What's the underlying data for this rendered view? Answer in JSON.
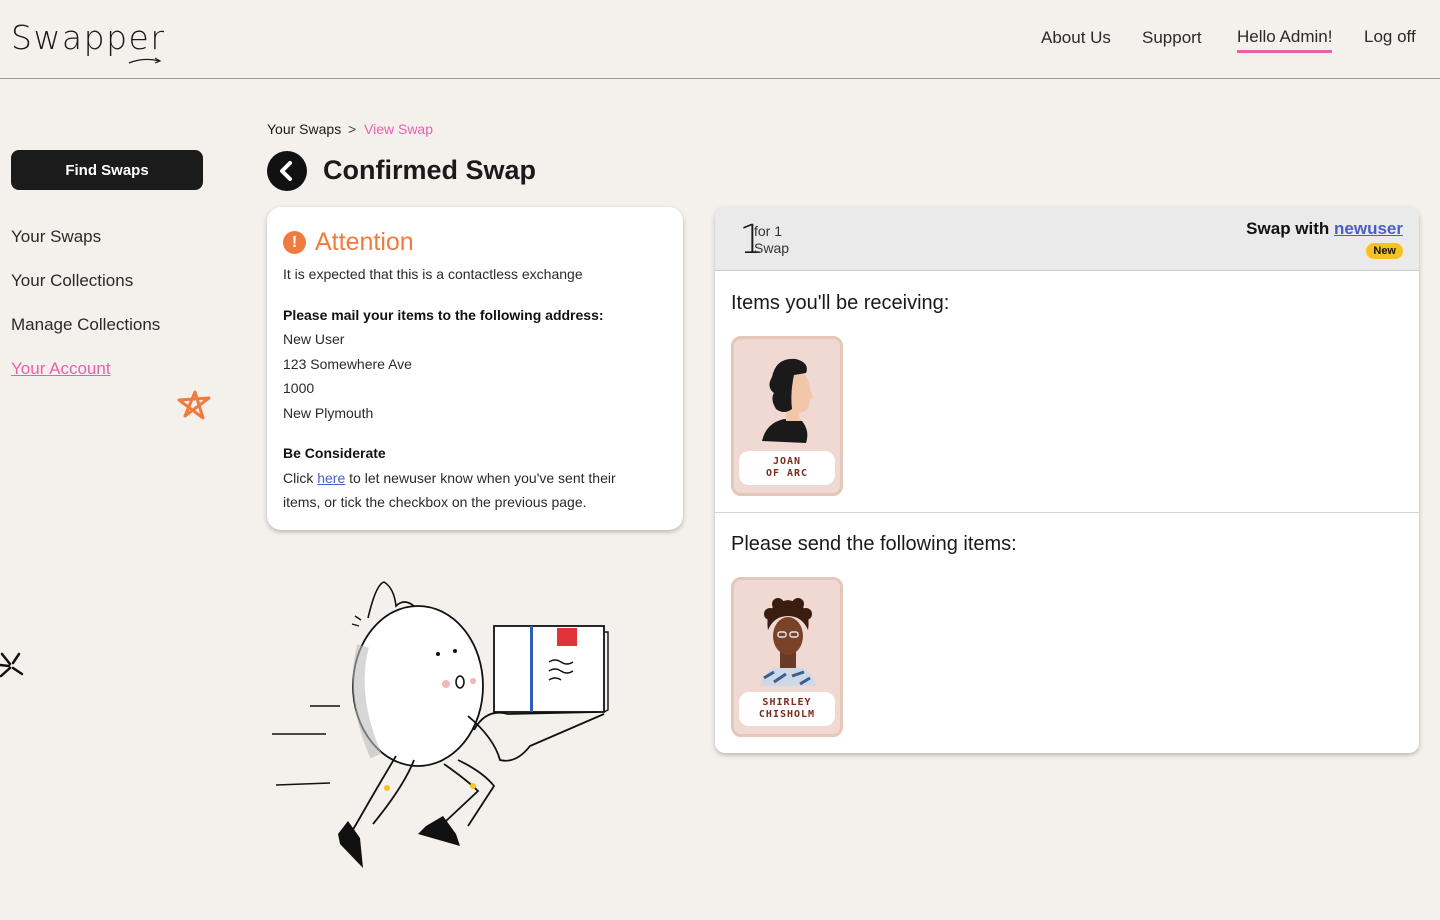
{
  "header": {
    "logo": "Swapper",
    "nav": [
      {
        "label": "About Us"
      },
      {
        "label": "Support"
      },
      {
        "label": "Hello Admin!"
      },
      {
        "label": "Log off"
      }
    ]
  },
  "sidebar": {
    "find_button": "Find Swaps",
    "items": [
      {
        "label": "Your Swaps"
      },
      {
        "label": "Your Collections"
      },
      {
        "label": "Manage Collections"
      },
      {
        "label": "Your Account"
      }
    ]
  },
  "breadcrumb": {
    "parent": "Your Swaps",
    "separator": ">",
    "current": "View Swap"
  },
  "page": {
    "title": "Confirmed Swap"
  },
  "attention": {
    "title": "Attention",
    "subtitle": "It is expected that this is a contactless exchange",
    "mail_heading": "Please mail your items to the following address:",
    "address": [
      "New User",
      "123 Somewhere Ave",
      "1000",
      "New Plymouth"
    ],
    "considerate_heading": "Be Considerate",
    "considerate_before": "Click ",
    "considerate_link": "here",
    "considerate_after": " to let newuser know when you've sent their",
    "considerate_line2": "items, or tick the checkbox on the previous page."
  },
  "swap": {
    "ratio_number": "1",
    "ratio_for": "for 1",
    "ratio_label": "Swap",
    "with_prefix": "Swap with ",
    "with_user": "newuser",
    "badge": "New",
    "receiving_title": "Items you'll be receiving:",
    "receiving_items": [
      {
        "name_line1": "JOAN",
        "name_line2": "OF ARC"
      }
    ],
    "sending_title": "Please send the following items:",
    "sending_items": [
      {
        "name_line1": "SHIRLEY",
        "name_line2": "CHISHOLM"
      }
    ]
  },
  "colors": {
    "accent_pink": "#ec5fae",
    "attention_orange": "#f07b3f",
    "badge_yellow": "#f8c21e",
    "link_blue": "#4a5ec9"
  }
}
